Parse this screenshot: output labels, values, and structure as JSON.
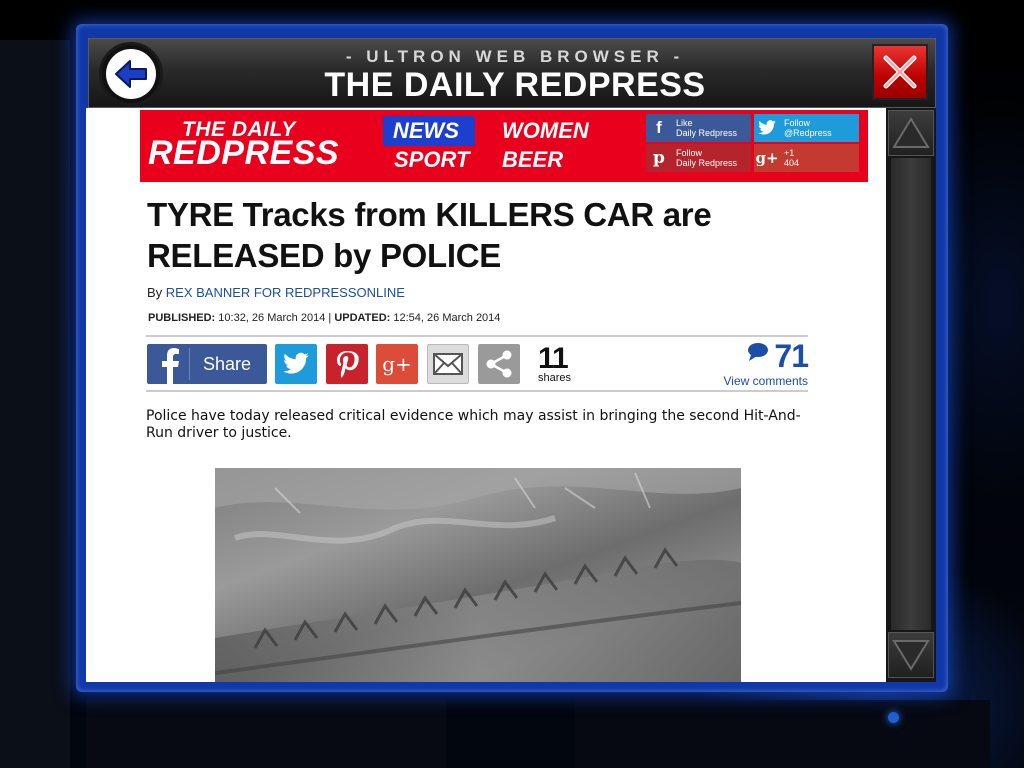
{
  "browser": {
    "subtitle": "- ULTRON WEB BROWSER -",
    "title": "THE DAILY REDPRESS",
    "back_icon": "back-arrow-icon",
    "close_icon": "close-x-icon",
    "frame_color": "#1238a8",
    "close_color": "#d11a1a"
  },
  "site": {
    "logo_line1": "THE DAILY",
    "logo_line2": "REDPRESS",
    "brand_color": "#e8001c",
    "nav": [
      {
        "label": "NEWS",
        "active": true
      },
      {
        "label": "WOMEN",
        "active": false
      },
      {
        "label": "SPORT",
        "active": false
      },
      {
        "label": "BEER",
        "active": false
      }
    ],
    "social": [
      {
        "icon": "facebook-icon",
        "glyph": "f",
        "line1": "Like",
        "line2": "Daily Redpress",
        "color": "#3b5998"
      },
      {
        "icon": "twitter-icon",
        "glyph": "t",
        "line1": "Follow",
        "line2": "@Redpress",
        "color": "#1da1f2"
      },
      {
        "icon": "pinterest-icon",
        "glyph": "p",
        "line1": "Follow",
        "line2": "Daily Redpress",
        "color": "#c8232c"
      },
      {
        "icon": "google-plus-icon",
        "glyph": "g+",
        "line1": "+1",
        "line2": "404",
        "color": "#dd4b39"
      }
    ]
  },
  "article": {
    "headline": "TYRE Tracks from KILLERS CAR are RELEASED by POLICE",
    "by_prefix": "By",
    "author": "REX BANNER FOR REDPRESSONLINE",
    "published_label": "PUBLISHED:",
    "published_value": "10:32, 26 March 2014",
    "separator": "|",
    "updated_label": "UPDATED:",
    "updated_value": "12:54, 26 March 2014",
    "share_label": "Share",
    "share_count": "11",
    "shares_label": "shares",
    "comment_count": "71",
    "comments_link": "View comments",
    "body": "Police have today released critical evidence which may assist in bringing the second Hit-And-Run driver to justice.",
    "image_desc_icon": "tyre-track-photo"
  },
  "share_buttons": [
    {
      "icon": "facebook-icon",
      "color": "#3b5998"
    },
    {
      "icon": "twitter-icon",
      "color": "#1da1f2"
    },
    {
      "icon": "pinterest-icon",
      "color": "#c8232c"
    },
    {
      "icon": "google-plus-icon",
      "color": "#dd4b39"
    },
    {
      "icon": "email-icon",
      "color": "#d8d8d8"
    },
    {
      "icon": "share-icon",
      "color": "#9a9a9a"
    }
  ],
  "scrollbar": {
    "up_icon": "scroll-up-arrow-icon",
    "down_icon": "scroll-down-arrow-icon"
  }
}
